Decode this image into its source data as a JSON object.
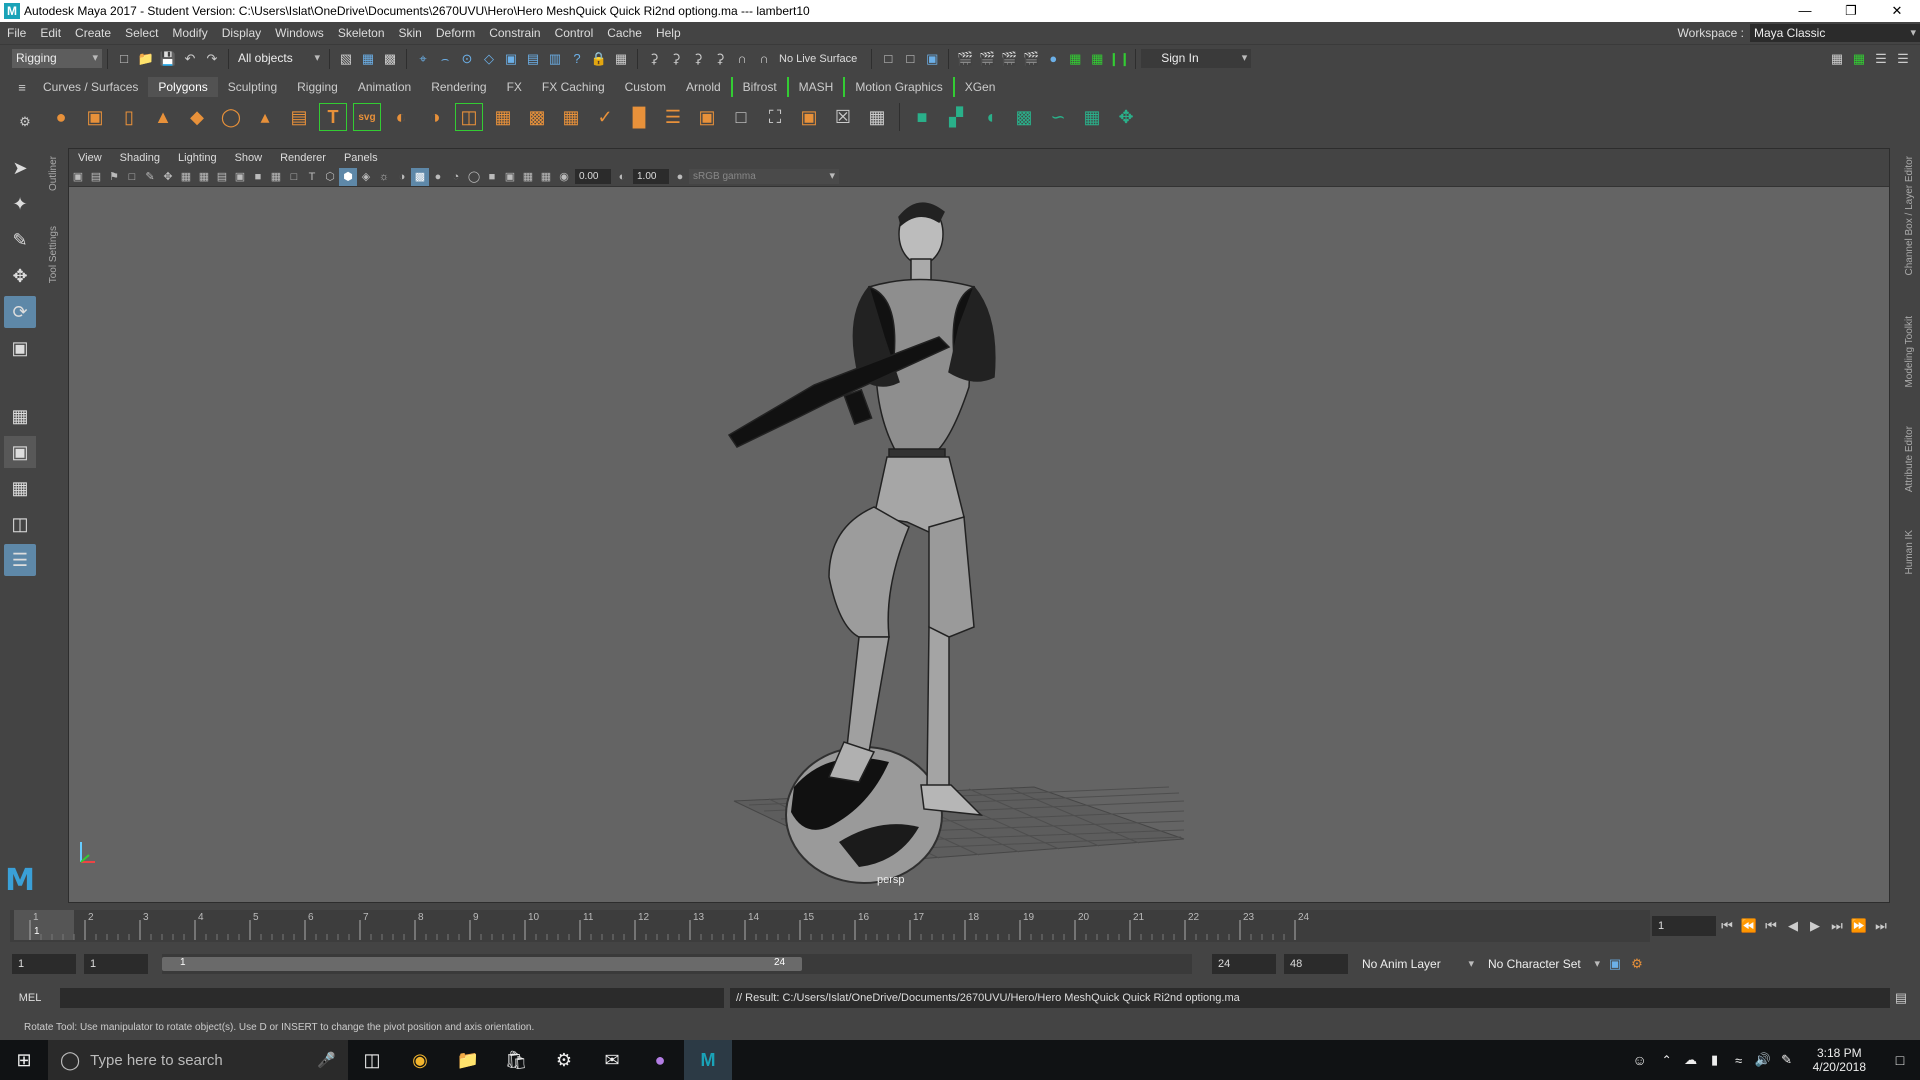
{
  "window": {
    "title": "Autodesk Maya 2017 - Student Version: C:\\Users\\Islat\\OneDrive\\Documents\\2670UVU\\Hero\\Hero MeshQuick Quick Ri2nd optiong.ma   ---   lambert10"
  },
  "menu": {
    "items": [
      "File",
      "Edit",
      "Create",
      "Select",
      "Modify",
      "Display",
      "Windows",
      "Skeleton",
      "Skin",
      "Deform",
      "Constrain",
      "Control",
      "Cache",
      "Help"
    ],
    "workspace_label": "Workspace :",
    "workspace_value": "Maya Classic"
  },
  "status": {
    "menuset": "Rigging",
    "selection_mask": "All objects",
    "live_surface": "No Live Surface",
    "sign_in": "Sign In"
  },
  "shelf": {
    "tabs": [
      "Curves / Surfaces",
      "Polygons",
      "Sculpting",
      "Rigging",
      "Animation",
      "Rendering",
      "FX",
      "FX Caching",
      "Custom",
      "Arnold",
      "Bifrost",
      "MASH",
      "Motion Graphics",
      "XGen"
    ],
    "active_tab": "Polygons",
    "icons": [
      "sphere-icon",
      "cube-icon",
      "cylinder-icon",
      "cone-icon",
      "plane-icon",
      "torus-icon",
      "pyramid-icon",
      "pipe-icon",
      "text-icon",
      "svg-icon",
      "combine-icon",
      "separate-icon",
      "mirror-icon",
      "smooth-icon",
      "extrude-icon",
      "bridge-icon",
      "insert-edge-icon",
      "multicut-icon",
      "bevel-icon",
      "target-weld-icon",
      "bounding-box-icon",
      "center-pivot-icon",
      "freeze-icon",
      "delete-history-icon",
      "uv-planar-icon",
      "uv-cylindrical-icon",
      "uv-spherical-icon",
      "uv-automatic-icon",
      "uv-cut-icon",
      "uv-editor-icon",
      "uv-unfold-icon"
    ],
    "text_icon_glyph": "T",
    "svg_icon_glyph": "svg"
  },
  "side_tabs": {
    "left": [
      "Outliner",
      "Tool Settings"
    ],
    "right": [
      "Channel Box / Layer Editor",
      "Modeling Toolkit",
      "Attribute Editor",
      "Human IK"
    ]
  },
  "panel": {
    "menus": [
      "View",
      "Shading",
      "Lighting",
      "Show",
      "Renderer",
      "Panels"
    ],
    "exposure": "0.00",
    "gamma": "1.00",
    "color_space": "sRGB gamma",
    "camera_label": "persp"
  },
  "timeline": {
    "ticks": [
      "1",
      "2",
      "3",
      "4",
      "5",
      "6",
      "7",
      "8",
      "9",
      "10",
      "11",
      "12",
      "13",
      "14",
      "15",
      "16",
      "17",
      "18",
      "19",
      "20",
      "21",
      "22",
      "23",
      "24"
    ],
    "current_frame": "1",
    "current_frame_field": "1"
  },
  "range": {
    "start": "1",
    "playback_start": "1",
    "slider_start": "1",
    "slider_end": "24",
    "playback_end": "24",
    "end": "48",
    "anim_layer": "No Anim Layer",
    "character_set": "No Character Set"
  },
  "command": {
    "mode": "MEL",
    "result": "// Result: C:/Users/Islat/OneDrive/Documents/2670UVU/Hero/Hero MeshQuick Quick Ri2nd optiong.ma"
  },
  "help_line": "Rotate Tool: Use manipulator to rotate object(s). Use D or INSERT to change the pivot position and axis orientation.",
  "taskbar": {
    "search_placeholder": "Type here to search",
    "time": "3:18 PM",
    "date": "4/20/2018"
  },
  "colors": {
    "accent_blue": "#5e88a8",
    "shelf_bracket_green": "#33cc33",
    "viewport_bg": "#646464"
  }
}
